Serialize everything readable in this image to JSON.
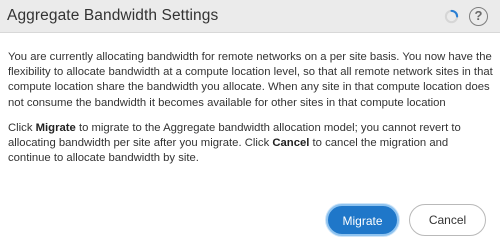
{
  "dialog": {
    "title": "Aggregate Bandwidth Settings",
    "icons": [
      "loading-spinner-icon",
      "help-icon"
    ],
    "help_glyph": "?",
    "paragraph1": "You are currently allocating bandwidth for remote networks on a per site basis. You now have the flexibility to allocate bandwidth at a compute location level, so that all remote network sites in that compute location share the bandwidth you allocate. When any site in that compute location does not consume the bandwidth it becomes available for other sites in that compute location",
    "paragraph2": {
      "part1": "Click ",
      "bold1": "Migrate",
      "part2": " to migrate to the Aggregate bandwidth allocation model; you cannot revert to allocating bandwidth per site after you migrate. Click ",
      "bold2": "Cancel",
      "part3": " to cancel the migration and continue to allocate bandwidth by site."
    },
    "buttons": {
      "migrate": "Migrate",
      "cancel": "Cancel"
    },
    "colors": {
      "header_bg": "#ebebeb",
      "primary_button": "#1f77c9",
      "spinner": "#2a7fd4"
    }
  }
}
